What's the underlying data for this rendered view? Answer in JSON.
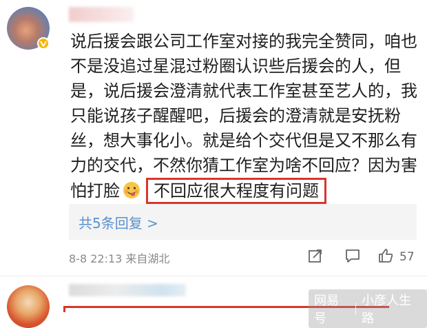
{
  "comment": {
    "lines": [
      "说后援会跟公司工作室对接的我完全赞同，咱也",
      "不是没追过星混过粉圈认识些后援会的人，但",
      "是，说后援会澄清就代表工作室甚至艺人的，我",
      "只能说孩子醒醒吧，后援会的澄清就是安抚粉",
      "丝，想大事化小。就是给个交代但是又不那么有",
      "力的交代，不然你猜工作室为啥不回应？因为害"
    ],
    "last_line_prefix": "怕打脸",
    "emoji": "yum-emoji-icon",
    "highlighted": "不回应很大程度有问题"
  },
  "replies": {
    "link_text": "共5条回复 >"
  },
  "meta": {
    "time_location": "8-8 22:13 来自湖北"
  },
  "actions": {
    "like_count": "57",
    "share_icon": "share-icon",
    "comment_icon": "comment-icon",
    "like_icon": "thumbs-up-icon"
  },
  "watermark": {
    "brand": "网易号",
    "author": "小彦人生路"
  },
  "colors": {
    "highlight_border": "#d9362b",
    "link": "#5a8fd0",
    "verified": "#f7b500"
  }
}
